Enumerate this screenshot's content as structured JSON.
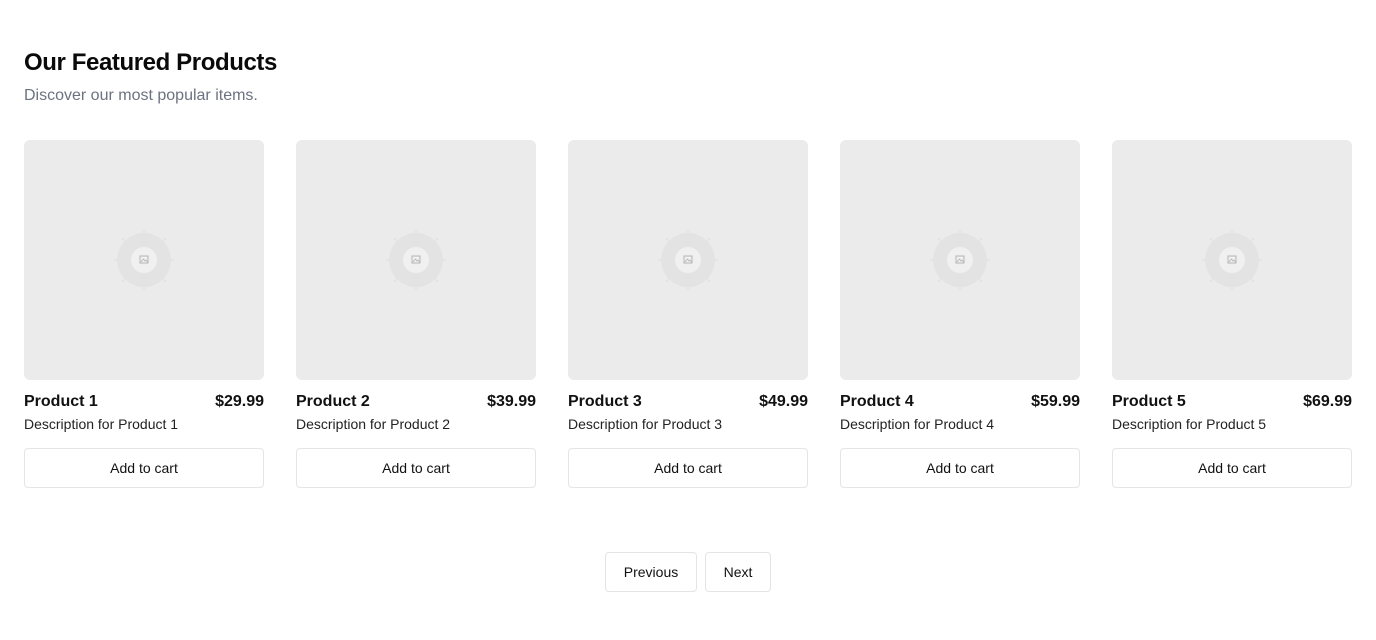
{
  "header": {
    "title": "Our Featured Products",
    "subtitle": "Discover our most popular items."
  },
  "products": [
    {
      "name": "Product 1",
      "price": "$29.99",
      "description": "Description for Product 1",
      "button_label": "Add to cart",
      "image_icon": "image-placeholder-icon"
    },
    {
      "name": "Product 2",
      "price": "$39.99",
      "description": "Description for Product 2",
      "button_label": "Add to cart",
      "image_icon": "image-placeholder-icon"
    },
    {
      "name": "Product 3",
      "price": "$49.99",
      "description": "Description for Product 3",
      "button_label": "Add to cart",
      "image_icon": "image-placeholder-icon"
    },
    {
      "name": "Product 4",
      "price": "$59.99",
      "description": "Description for Product 4",
      "button_label": "Add to cart",
      "image_icon": "image-placeholder-icon"
    },
    {
      "name": "Product 5",
      "price": "$69.99",
      "description": "Description for Product 5",
      "button_label": "Add to cart",
      "image_icon": "image-placeholder-icon"
    }
  ],
  "pagination": {
    "previous_label": "Previous",
    "next_label": "Next"
  },
  "colors": {
    "placeholder_bg": "#ebebeb",
    "border": "#e4e4e7",
    "subtitle": "#6b7280"
  }
}
